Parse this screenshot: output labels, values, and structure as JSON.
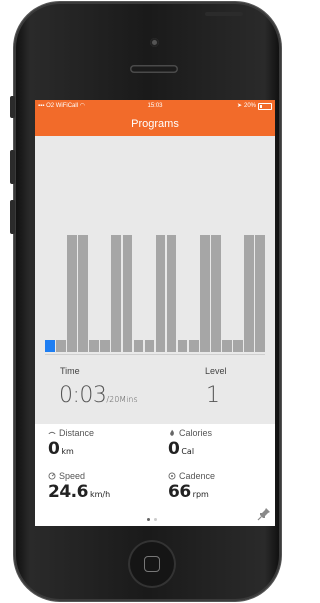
{
  "status_bar": {
    "carrier": "O2 WiFiCall",
    "time": "15:03",
    "battery": "20%"
  },
  "nav": {
    "title": "Programs"
  },
  "program_chart": {
    "levels": [
      1,
      1,
      10,
      10,
      1,
      1,
      10,
      10,
      1,
      1,
      10,
      10,
      1,
      1,
      10,
      10,
      1,
      1,
      10,
      10
    ],
    "active_index": 0,
    "colors": {
      "bar": "#a6a6a6",
      "active": "#1e7ef2"
    }
  },
  "program": {
    "time_label": "Time",
    "time_value": "0:03",
    "time_total": "/20Mins",
    "level_label": "Level",
    "level_value": "1"
  },
  "stats": {
    "distance": {
      "label": "Distance",
      "value": "0",
      "unit": "km"
    },
    "calories": {
      "label": "Calories",
      "value": "0",
      "unit": "Cal"
    },
    "speed": {
      "label": "Speed",
      "value": "24.6",
      "unit": "km/h"
    },
    "cadence": {
      "label": "Cadence",
      "value": "66",
      "unit": "rpm"
    }
  },
  "pager": {
    "pages": 2,
    "current": 0
  },
  "colors": {
    "accent": "#f26b2a"
  }
}
